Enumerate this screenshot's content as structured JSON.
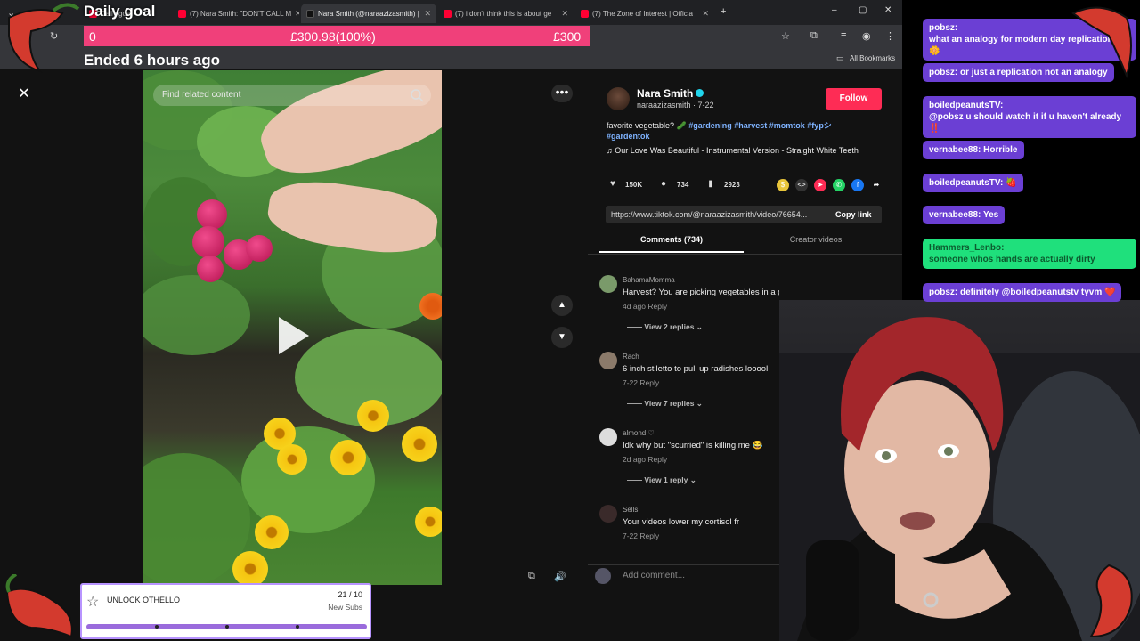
{
  "browser": {
    "tabs": [
      {
        "title": "Daily goal",
        "active": false,
        "favicon_color": "#ff0033"
      },
      {
        "title": "(7) Nara Smith: \"DON'T CALL M",
        "active": false,
        "favicon_color": "#ff0033"
      },
      {
        "title": "Nara Smith (@naraazizasmith) |",
        "active": true,
        "favicon_color": "#111111"
      },
      {
        "title": "(7) i don't think this is about ge",
        "active": false,
        "favicon_color": "#ff0033"
      },
      {
        "title": "(7) The Zone of Interest | Officia",
        "active": false,
        "favicon_color": "#ff0033"
      }
    ],
    "new_tab": "+",
    "bookmarks_label": "All Bookmarks"
  },
  "goal": {
    "title": "Daily goal",
    "start": "0",
    "current": "£300.98(100%)",
    "target": "£300",
    "status": "Ended 6 hours ago",
    "progress": 1.0
  },
  "video": {
    "search_placeholder": "Find related content",
    "close_icon": "✕",
    "more_icon": "•••",
    "up_icon": "▲",
    "down_icon": "▼"
  },
  "post": {
    "author_name": "Nara Smith",
    "author_handle": "naraazizasmith · 7-22",
    "follow_label": "Follow",
    "caption_text": "favorite vegetable? 🥒 ",
    "caption_tags": "#gardening #harvest #momtok #fypシ #gardentok",
    "music": "♫  Our Love Was Beautiful - Instrumental Version - Straight White Teeth",
    "likes": "150K",
    "comments": "734",
    "saves": "2923",
    "link": "https://www.tiktok.com/@naraazizasmith/video/76654...",
    "copy_link_label": "Copy link",
    "tab_comments": "Comments (734)",
    "tab_creator": "Creator videos",
    "add_comment_placeholder": "Add comment..."
  },
  "comments": [
    {
      "user": "BahamaMomma",
      "text": "Harvest? You are picking vegetables in a garde",
      "meta": "4d ago   Reply",
      "replies": "View 2 replies ⌄",
      "avatar_color": "#7a9a6a"
    },
    {
      "user": "Rach",
      "text": "6 inch stiletto to pull up radishes looool",
      "meta": "7-22   Reply",
      "replies": "View 7 replies ⌄",
      "avatar_color": "#8b7a6a"
    },
    {
      "user": "almond ♡",
      "text": "Idk why but \"scurried\" is killing me 😂",
      "meta": "2d ago   Reply",
      "replies": "View 1 reply ⌄",
      "avatar_color": "#dddddd"
    },
    {
      "user": "Sells",
      "text": "Your videos lower my cortisol fr",
      "meta": "7-22   Reply",
      "replies": "",
      "avatar_color": "#3a2a2a"
    }
  ],
  "chat": [
    {
      "user": "pobsz:",
      "text": "what an analogy for modern day replications 🌼",
      "style": "purple"
    },
    {
      "user": "pobsz:",
      "text": "or just a replication not an analogy",
      "style": "purple"
    },
    {
      "user": "boiledpeanutsTV:",
      "text": "@pobsz u should watch it if u haven't already ‼️",
      "style": "purple"
    },
    {
      "user": "vernabee88:",
      "text": "Horrible",
      "style": "purple"
    },
    {
      "user": "boiledpeanutsTV:",
      "text": "🍓",
      "style": "purple"
    },
    {
      "user": "vernabee88:",
      "text": "Yes",
      "style": "purple"
    },
    {
      "user": "Hammers_Lenbo:",
      "text": "someone whos hands are actually dirty",
      "style": "green"
    },
    {
      "user": "pobsz:",
      "text": "definitely @boiledpeanutstv tyvm ❤️",
      "style": "purple"
    }
  ],
  "unlock": {
    "title": "UNLOCK OTHELLO",
    "count": "21 / 10",
    "sub": "New Subs",
    "progress": 1.0
  },
  "colors": {
    "goal_pink": "#f0407a",
    "follow_red": "#fe2c55",
    "chat_purple": "#6b3fd4",
    "chat_green": "#1fe07c",
    "unlock_purple": "#9a6bdc"
  }
}
